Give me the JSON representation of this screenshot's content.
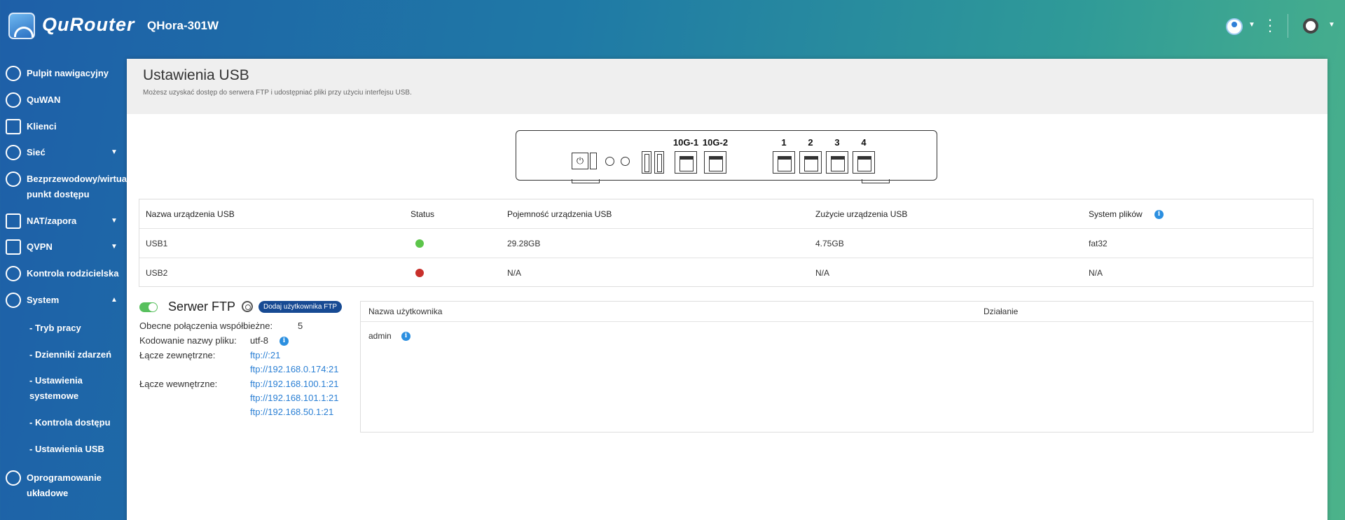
{
  "header": {
    "brand": "QuRouter",
    "model": "QHora-301W",
    "icons": [
      "user-avatar-icon",
      "more-vertical-icon",
      "language-globe-icon"
    ]
  },
  "sidebar": {
    "items": [
      {
        "label": "Pulpit nawigacyjny",
        "icon": "dashboard-icon"
      },
      {
        "label": "QuWAN",
        "icon": "quwan-icon"
      },
      {
        "label": "Klienci",
        "icon": "clients-icon"
      },
      {
        "label": "Sieć",
        "icon": "network-globe-icon"
      },
      {
        "label": "Bezprzewodowy/wirtualny",
        "label2": "punkt dostępu",
        "icon": "wireless-icon"
      },
      {
        "label": "NAT/zapora",
        "icon": "firewall-icon"
      },
      {
        "label": "QVPN",
        "icon": "vpn-lock-icon"
      },
      {
        "label": "Kontrola rodzicielska",
        "icon": "parental-icon"
      },
      {
        "label": "System",
        "icon": "system-gear-icon"
      },
      {
        "label": "Oprogramowanie",
        "label2": "układowe",
        "icon": "firmware-icon"
      }
    ],
    "system_sub": [
      {
        "label": "- Tryb pracy"
      },
      {
        "label": "- Dzienniki zdarzeń"
      },
      {
        "label": "- Ustawienia",
        "label2": "systemowe"
      },
      {
        "label": "- Kontrola dostępu"
      },
      {
        "label": "- Ustawienia USB"
      }
    ]
  },
  "page": {
    "title": "Ustawienia USB",
    "description": "Możesz uzyskać dostęp do serwera FTP i udostępniać pliki przy użyciu interfejsu USB."
  },
  "device": {
    "port_labels": [
      "10G-1",
      "10G-2",
      "1",
      "2",
      "3",
      "4"
    ]
  },
  "usb_table": {
    "headers": [
      "Nazwa urządzenia USB",
      "Status",
      "Pojemność urządzenia USB",
      "Zużycie urządzenia USB",
      "System plików"
    ],
    "rows": [
      {
        "name": "USB1",
        "status_color": "#5cc54a",
        "capacity": "29.28GB",
        "usage": "4.75GB",
        "fs": "fat32"
      },
      {
        "name": "USB2",
        "status_color": "#c8302b",
        "capacity": "N/A",
        "usage": "N/A",
        "fs": "N/A"
      }
    ]
  },
  "ftp": {
    "enabled": true,
    "title": "Serwer FTP",
    "add_user_label": "Dodaj użytkownika FTP",
    "connections_label": "Obecne połączenia współbieżne:",
    "connections_value": "5",
    "encoding_label": "Kodowanie nazwy pliku:",
    "encoding_value": "utf-8",
    "external_label": "Łącze zewnętrzne:",
    "external_links": [
      "ftp://:21",
      "ftp://192.168.0.174:21"
    ],
    "internal_label": "Łącze wewnętrzne:",
    "internal_links": [
      "ftp://192.168.100.1:21",
      "ftp://192.168.101.1:21",
      "ftp://192.168.50.1:21"
    ]
  },
  "users_table": {
    "headers": [
      "Nazwa użytkownika",
      "Działanie"
    ],
    "rows": [
      {
        "name": "admin"
      }
    ]
  },
  "colors": {
    "accent": "#174a93",
    "link": "#2a7fd4",
    "toggle_on": "#58c05e"
  }
}
